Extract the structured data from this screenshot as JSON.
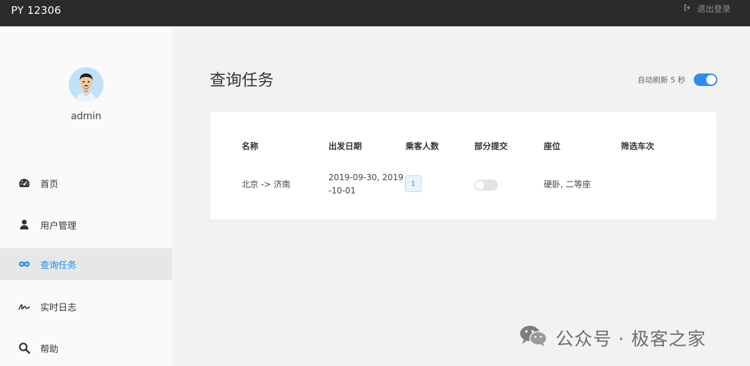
{
  "app": {
    "title": "PY 12306"
  },
  "header": {
    "logout_label": "退出登录",
    "logout_icon": "sign-out-icon"
  },
  "sidebar": {
    "username": "admin",
    "items": [
      {
        "label": "首页",
        "icon": "dashboard-icon",
        "active": false
      },
      {
        "label": "用户管理",
        "icon": "user-icon",
        "active": false
      },
      {
        "label": "查询任务",
        "icon": "infinity-icon",
        "active": true
      },
      {
        "label": "实时日志",
        "icon": "signature-icon",
        "active": false
      },
      {
        "label": "帮助",
        "icon": "search-icon",
        "active": false
      }
    ]
  },
  "main": {
    "title": "查询任务",
    "auto_refresh": {
      "label": "自动刷新 5 秒",
      "enabled": true
    }
  },
  "table": {
    "headers": [
      "名称",
      "出发日期",
      "乘客人数",
      "部分提交",
      "座位",
      "筛选车次"
    ],
    "rows": [
      {
        "name": "北京 -> 济南",
        "date_line1": "2019-09-30, 2019",
        "date_line2": "-10-01",
        "passengers": "1",
        "partial_submit": false,
        "seats": "硬卧, 二等座",
        "train_filter": ""
      }
    ]
  },
  "watermark": {
    "text": "公众号 · 极客之家"
  },
  "colors": {
    "accent": "#2d8cf0",
    "topbar": "#2b2b2b",
    "sidebar_bg": "#fafafa",
    "active_bg": "#e7e7e7"
  }
}
